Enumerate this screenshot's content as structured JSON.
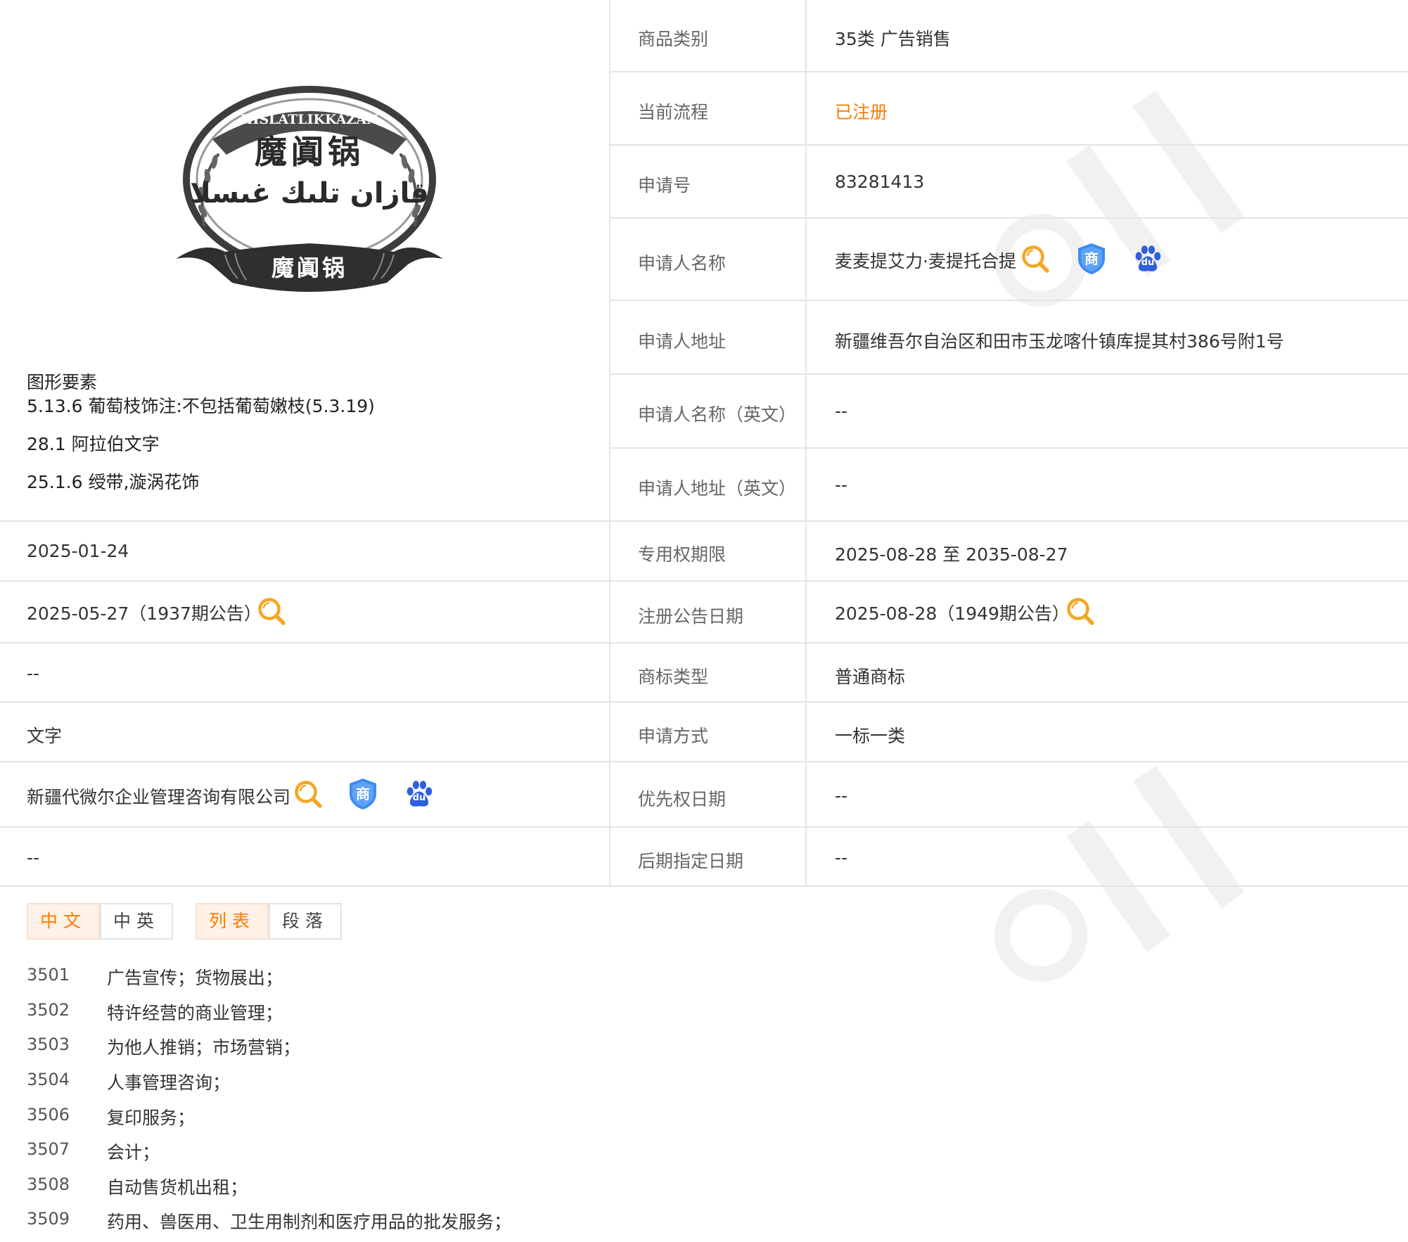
{
  "logo": {
    "banner_text": "HISLATLIKKAZAN",
    "chinese_text": "魔阗锅",
    "arabic_text": "قازان تلىك غىسلا",
    "ribbon_text": "魔阗锅"
  },
  "figure_elements": {
    "title": "图形要素",
    "items": [
      "5.13.6 葡萄枝饰注:不包括葡萄嫩枝(5.3.19)",
      "28.1 阿拉伯文字",
      "25.1.6 绶带,漩涡花饰"
    ]
  },
  "left_values": {
    "apply_date": "2025-01-24",
    "prelim_pub": "2025-05-27（1937期公告）",
    "row3": "--",
    "form": "文字",
    "agent": "新疆代微尔企业管理咨询有限公司",
    "row6": "--"
  },
  "details": {
    "category_label": "商品类别",
    "category_value": "35类 广告销售",
    "process_label": "当前流程",
    "process_value": "已注册",
    "appno_label": "申请号",
    "appno_value": "83281413",
    "applicant_label": "申请人名称",
    "applicant_value": "麦麦提艾力·麦提托合提",
    "address_label": "申请人地址",
    "address_value": "新疆维吾尔自治区和田市玉龙喀什镇库提其村386号附1号",
    "name_en_label": "申请人名称（英文）",
    "name_en_value": "--",
    "address_en_label": "申请人地址（英文）",
    "address_en_value": "--",
    "term_label": "专用权期限",
    "term_value": "2025-08-28 至 2035-08-27",
    "reg_pub_label": "注册公告日期",
    "reg_pub_value": "2025-08-28（1949期公告）",
    "type_label": "商标类型",
    "type_value": "普通商标",
    "method_label": "申请方式",
    "method_value": "一标一类",
    "priority_label": "优先权日期",
    "priority_value": "--",
    "later_label": "后期指定日期",
    "later_value": "--"
  },
  "icons": {
    "search": "search-icon",
    "trademark": "trademark-shield-icon",
    "baidu": "baidu-paw-icon",
    "shield_glyph": "商",
    "baidu_glyph": "du"
  },
  "tabs": {
    "lang_cn": "中文",
    "lang_cnen": "中英",
    "view_list": "列表",
    "view_para": "段落"
  },
  "services": [
    {
      "code": "3501",
      "name": "广告宣传；货物展出；"
    },
    {
      "code": "3502",
      "name": "特许经营的商业管理；"
    },
    {
      "code": "3503",
      "name": "为他人推销；市场营销；"
    },
    {
      "code": "3504",
      "name": "人事管理咨询；"
    },
    {
      "code": "3506",
      "name": "复印服务；"
    },
    {
      "code": "3507",
      "name": "会计；"
    },
    {
      "code": "3508",
      "name": "自动售货机出租；"
    },
    {
      "code": "3509",
      "name": "药用、兽医用、卫生用制剂和医疗用品的批发服务；"
    }
  ],
  "colors": {
    "accent": "#ff7b00",
    "search_icon": "#f5a623",
    "shield_icon": "#3d8bf2",
    "baidu_icon": "#2f5fde",
    "border": "#e4e4e4",
    "label_text": "#666666"
  }
}
